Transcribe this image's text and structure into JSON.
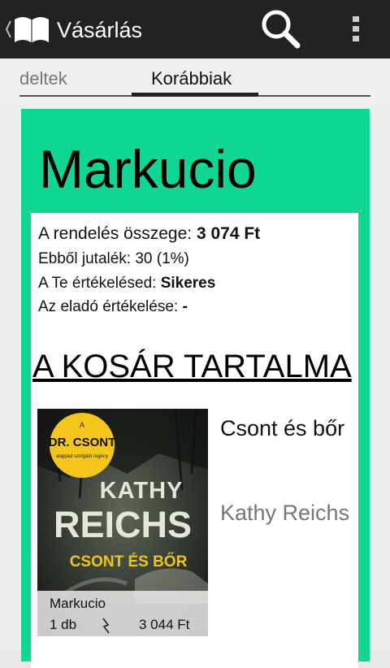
{
  "app": {
    "title": "Vásárlás",
    "icons": {
      "up": "chevron-left-icon",
      "logo": "open-book-icon",
      "search": "search-icon",
      "overflow": "more-vertical-icon"
    }
  },
  "tabs": {
    "previous_label": "deltek",
    "current_label": "Korábbiak"
  },
  "order": {
    "seller_name": "Markucio",
    "total_label": "A rendelés összege: ",
    "total_value": "3 074 Ft",
    "reward_label": "Ebből jutalék: 30 (1%)",
    "your_rating_label": "A Te értékelésed: ",
    "your_rating_value": "Sikeres",
    "seller_rating_label": "Az eladó értékelése: ",
    "seller_rating_value": "-"
  },
  "cart": {
    "heading": "A KOSÁR TARTALMA",
    "items": [
      {
        "title": "Csont és bőr",
        "author": "Kathy Reichs",
        "seller": "Markucio",
        "quantity": "1 db",
        "price": "3 044 Ft",
        "cover": {
          "badge_small": "A",
          "badge_main": "DR. CSONT",
          "badge_sub": "alapjául szolgáló regény",
          "author_first": "KATHY",
          "author_last": "REICHS",
          "title": "CSONT ÉS BŐR"
        }
      }
    ]
  },
  "colors": {
    "action_bar": "#222222",
    "card_accent": "#0fd694",
    "badge": "#f4c61b"
  }
}
